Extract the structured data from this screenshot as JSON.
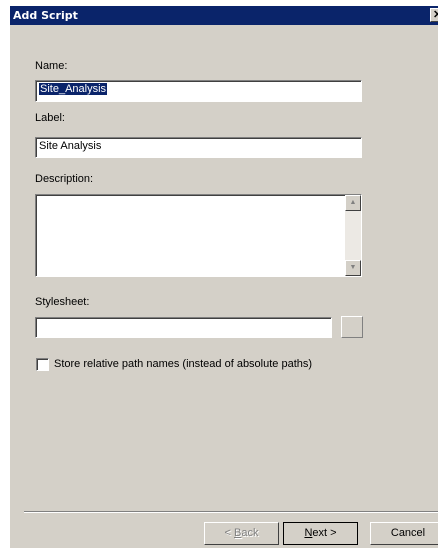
{
  "window": {
    "title": "Add Script",
    "close_glyph": "✕"
  },
  "form": {
    "name_label": "Name:",
    "name_value": "Site_Analysis",
    "label_label": "Label:",
    "label_value": "Site Analysis",
    "description_label": "Description:",
    "description_value": "",
    "stylesheet_label": "Stylesheet:",
    "stylesheet_value": "",
    "store_relative_label": "Store relative path names (instead of absolute paths)",
    "store_relative_checked": false
  },
  "icons": {
    "scroll_up": "arrow-up-icon",
    "scroll_down": "arrow-down-icon",
    "close": "close-icon"
  },
  "buttons": {
    "back_prefix": "< ",
    "back_mnemonic": "B",
    "back_rest": "ack",
    "next_mnemonic": "N",
    "next_rest": "ext >",
    "cancel": "Cancel"
  },
  "colors": {
    "titlebar": "#0a246a",
    "dialog": "#d4d0c8",
    "selection": "#0a246a"
  }
}
